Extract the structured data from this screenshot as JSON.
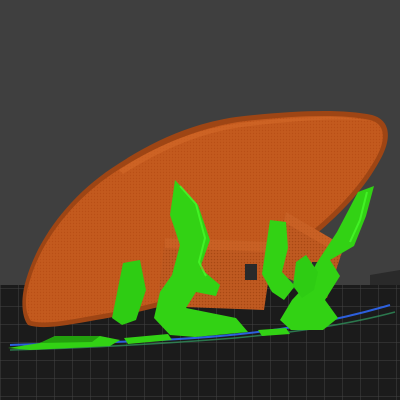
{
  "viewport": {
    "background_color": "#3f3f3f"
  },
  "scene": {
    "bed": {
      "color": "#1b1b1b",
      "grid_color": "#4a4a4a"
    },
    "model": {
      "color": "#c35a1e",
      "highlight_color": "#d56b2a",
      "shadow_color": "#9e4514"
    },
    "supports": {
      "color": "#32d214",
      "dark_color": "#23a00d",
      "accent_color": "#49ff2c"
    },
    "first_layer_outline_color": "#2f6bff"
  }
}
